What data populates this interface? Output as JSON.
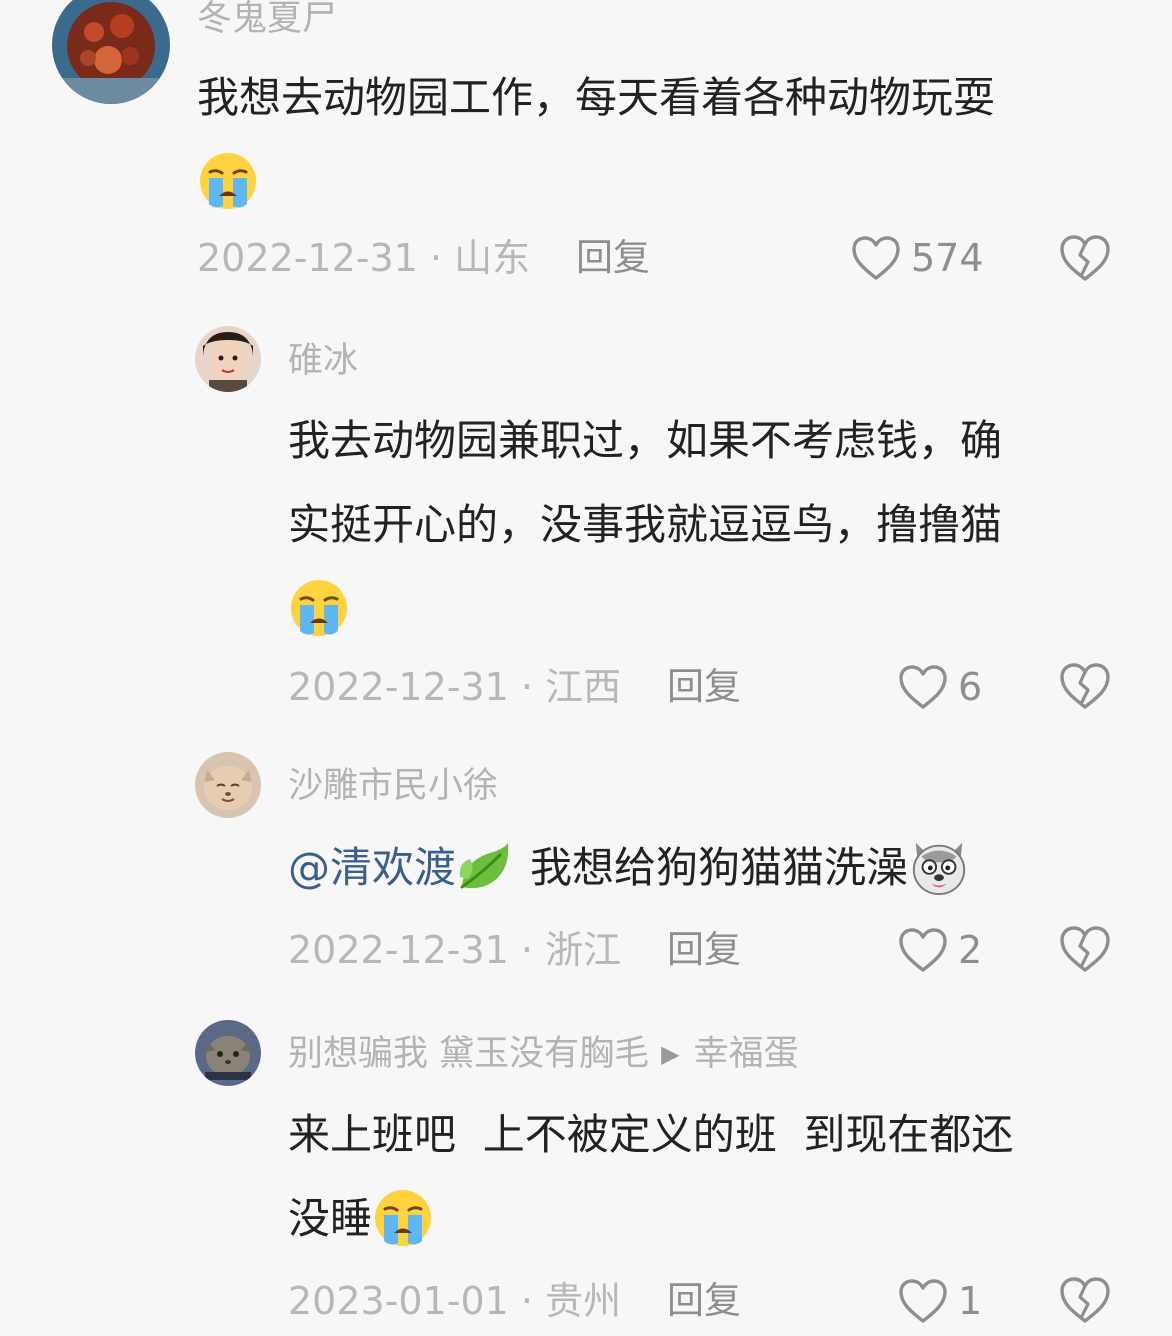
{
  "comments": [
    {
      "username": "冬鬼夏尸",
      "text_lines": [
        "我想去动物园工作，每天看着各种动物玩耍"
      ],
      "emoji": "crying-face",
      "date": "2022-12-31",
      "location": "山东",
      "reply_label": "回复",
      "likes": "574"
    },
    {
      "username": "碓冰",
      "text_lines": [
        "我去动物园兼职过，如果不考虑钱，确",
        "实挺开心的，没事我就逗逗鸟，撸撸猫"
      ],
      "emoji": "crying-face",
      "date": "2022-12-31",
      "location": "江西",
      "reply_label": "回复",
      "likes": "6"
    },
    {
      "username": "沙雕市民小徐",
      "mention": "@清欢渡",
      "mention_emoji": "leaf-icon",
      "text_after_mention": "我想给狗狗猫猫洗澡",
      "trailing_emoji": "dog-face",
      "date": "2022-12-31",
      "location": "浙江",
      "reply_label": "回复",
      "likes": "2"
    },
    {
      "username": "别想骗我 黛玉没有胸毛",
      "reply_to": "幸福蛋",
      "text_lines": [
        "来上班吧  上不被定义的班  到现在都还",
        "没睡"
      ],
      "emoji": "crying-face",
      "date": "2023-01-01",
      "location": "贵州",
      "reply_label": "回复",
      "likes": "1"
    }
  ],
  "colors": {
    "background": "#f7f7f7",
    "text": "#222222",
    "muted": "#b3b3b3",
    "mention": "#3a5f8a"
  }
}
